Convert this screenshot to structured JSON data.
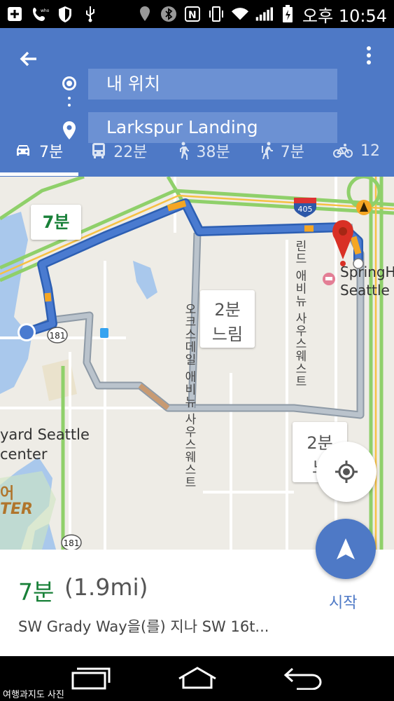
{
  "status_bar": {
    "time": "오후 10:54",
    "icons": [
      "add-icon",
      "whowho-call-icon",
      "shield-icon",
      "usb-icon",
      "location-icon",
      "bluetooth-icon",
      "nfc-icon",
      "vibrate-icon",
      "wifi-icon",
      "signal-icon",
      "battery-charging-icon"
    ]
  },
  "header": {
    "origin": "내 위치",
    "destination": "Larkspur Landing",
    "modes": [
      {
        "icon": "car-icon",
        "label": "7분",
        "active": true
      },
      {
        "icon": "transit-icon",
        "label": "22분",
        "active": false
      },
      {
        "icon": "walk-icon",
        "label": "38분",
        "active": false
      },
      {
        "icon": "ride-icon",
        "label": "7분",
        "active": false
      },
      {
        "icon": "bike-icon",
        "label": "12",
        "active": false
      }
    ]
  },
  "map": {
    "route_callout": "7분",
    "alt_callout_1": [
      "2분",
      "느림"
    ],
    "alt_callout_2": [
      "2분",
      "느"
    ],
    "street_1": "오크스데일 애비뉴 사우스웨스트",
    "street_2": "린드 애비뉴 사우스웨스트",
    "poi_left_1": "yard Seattle",
    "poi_left_2": "center",
    "poi_left_3": "어",
    "poi_left_4": "TER",
    "poi_right_1": "SpringH",
    "poi_right_2": "Seattle",
    "shield_405": "405",
    "shield_181_a": "181",
    "shield_181_b": "181"
  },
  "summary": {
    "duration": "7분",
    "distance": "(1.9mi)",
    "via": "SW Grady Way을(를) 지나 SW 16t...",
    "start_label": "시작"
  },
  "watermark": "여행과지도 사진",
  "colors": {
    "header_bg": "#4e79c6",
    "field_bg": "#6c91d3",
    "route_main": "#4a7bd0",
    "route_alt": "#a9b3bf",
    "duration_green": "#188038"
  }
}
